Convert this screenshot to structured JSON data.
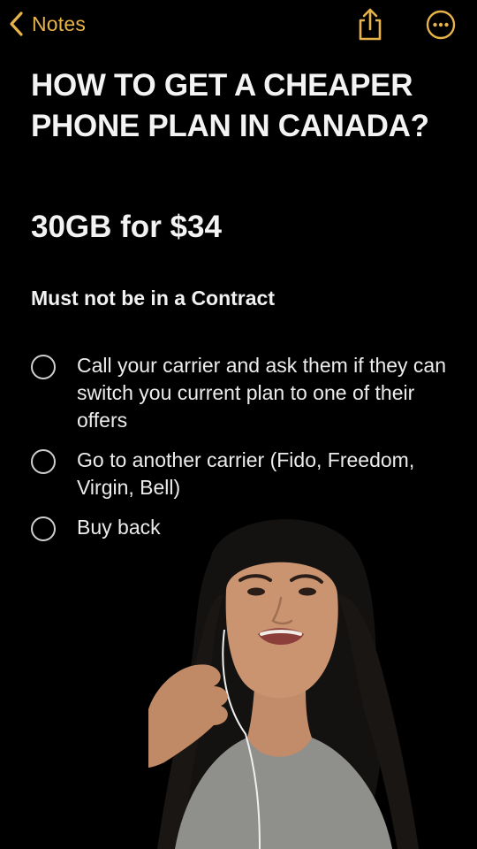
{
  "navbar": {
    "back_label": "Notes",
    "accent_color": "#e7b34a",
    "share_icon": "share-icon",
    "more_icon": "ellipsis-circle-icon"
  },
  "note": {
    "title": "HOW TO GET A CHEAPER PHONE PLAN IN CANADA?",
    "subtitle": "30GB for $34",
    "heading": "Must not be in a Contract",
    "checklist": [
      {
        "text": "Call your carrier and ask them if they can switch you current plan to one of their offers",
        "checked": false
      },
      {
        "text": "Go to another carrier (Fido, Freedom, Virgin, Bell)",
        "checked": false
      },
      {
        "text": "Buy back",
        "checked": false
      }
    ]
  },
  "colors": {
    "background": "#000000",
    "text": "#f3f3f3",
    "checkbox_border": "#cfcfcf"
  }
}
